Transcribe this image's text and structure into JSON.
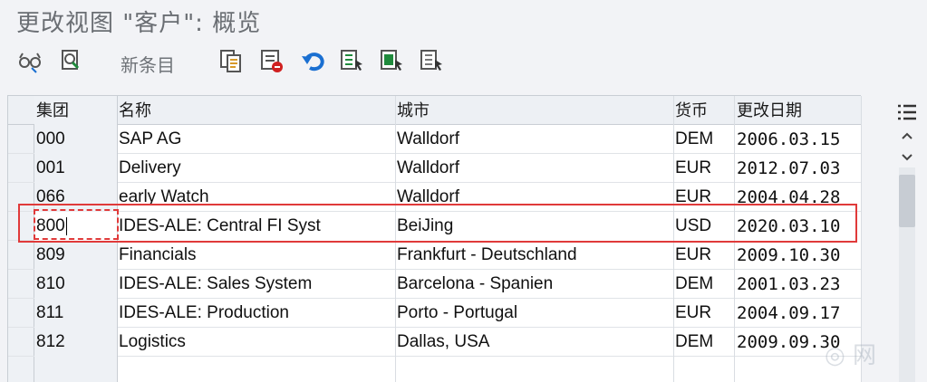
{
  "window": {
    "title": "更改视图 \"客户\": 概览"
  },
  "toolbar": {
    "new_entries_label": "新条目",
    "icons": [
      "glasses-search-icon",
      "display-change-icon",
      "copy-icon",
      "delete-icon",
      "undo-icon",
      "select-all-icon",
      "select-block-icon",
      "deselect-all-icon"
    ]
  },
  "table": {
    "columns": [
      "集团",
      "名称",
      "城市",
      "货币",
      "更改日期"
    ],
    "rows": [
      {
        "client": "000",
        "name": "SAP AG",
        "city": "Walldorf",
        "currency": "DEM",
        "date": "2006.03.15"
      },
      {
        "client": "001",
        "name": "Delivery",
        "city": "Walldorf",
        "currency": "EUR",
        "date": "2012.07.03"
      },
      {
        "client": "066",
        "name": "early Watch",
        "city": "Walldorf",
        "currency": "EUR",
        "date": "2004.04.28"
      },
      {
        "client": "800",
        "name": "IDES-ALE: Central FI Syst",
        "city": "BeiJing",
        "currency": "USD",
        "date": "2020.03.10"
      },
      {
        "client": "809",
        "name": "Financials",
        "city": "Frankfurt - Deutschland",
        "currency": "EUR",
        "date": "2009.10.30"
      },
      {
        "client": "810",
        "name": "IDES-ALE: Sales System",
        "city": "Barcelona - Spanien",
        "currency": "DEM",
        "date": "2001.03.23"
      },
      {
        "client": "811",
        "name": "IDES-ALE: Production",
        "city": "Porto - Portugal",
        "currency": "EUR",
        "date": "2004.09.17"
      },
      {
        "client": "812",
        "name": "Logistics",
        "city": "Dallas, USA",
        "currency": "DEM",
        "date": "2009.09.30"
      }
    ]
  },
  "side": {
    "icons": [
      "column-settings-icon",
      "scroll-up-icon",
      "scroll-down-icon"
    ]
  },
  "colors": {
    "highlight": "#e03a3a",
    "accent_blue": "#1a6fd1",
    "accent_green": "#1f8a3c"
  }
}
